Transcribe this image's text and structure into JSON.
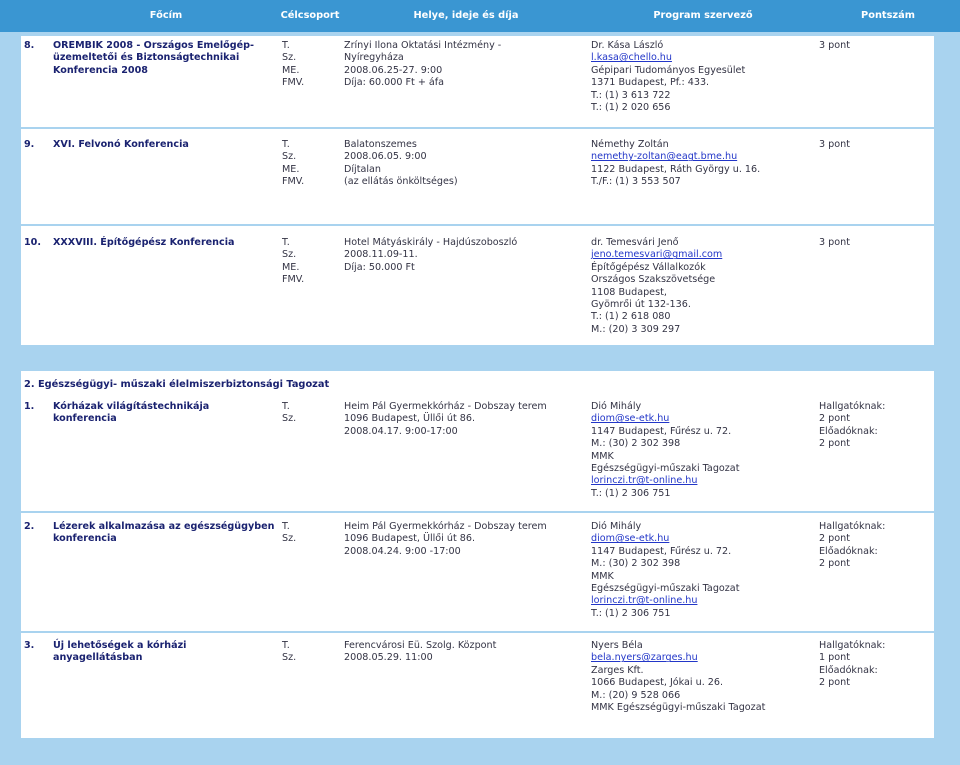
{
  "header": {
    "columns": [
      "Főcím",
      "Célcsoport",
      "Helye, ideje és díja",
      "Program szervező",
      "Pontszám"
    ]
  },
  "colors": {
    "header_bg": "#3a96d2",
    "page_bg": "#a9d3ef",
    "title_text": "#1a2270",
    "link": "#2236c8"
  },
  "sections": [
    {
      "rows": [
        {
          "num": "8.",
          "title": [
            "OREMBIK 2008 - Országos Emelőgép-",
            "üzemeltetői és Biztonságtechnikai",
            "Konferencia 2008"
          ],
          "labels": [
            "T.",
            "Sz.",
            "ME.",
            "FMV."
          ],
          "place": [
            "Zrínyi Ilona Oktatási Intézmény -",
            "Nyíregyháza",
            "2008.06.25-27. 9:00",
            "Díja: 60.000 Ft + áfa"
          ],
          "organizer": [
            "Dr. Kása László",
            "l.kasa@chello.hu",
            "Gépipari Tudományos Egyesület",
            "1371 Budapest, Pf.: 433.",
            "T.: (1) 3 613 722",
            "T.: (1) 2 020 656"
          ],
          "points": [
            "3 pont"
          ]
        },
        {
          "num": "9.",
          "title": [
            "XVI. Felvonó Konferencia"
          ],
          "labels": [
            "T.",
            "Sz.",
            "ME.",
            "FMV."
          ],
          "place": [
            "Balatonszemes",
            "2008.06.05. 9:00",
            "Díjtalan",
            "(az ellátás önköltséges)"
          ],
          "organizer": [
            "Némethy Zoltán",
            "nemethy-zoltan@eagt.bme.hu",
            "1122 Budapest, Ráth György u. 16.",
            "T./F.: (1) 3 553 507"
          ],
          "points": [
            "3 pont"
          ]
        },
        {
          "num": "10.",
          "title": [
            "XXXVIII. Építőgépész Konferencia"
          ],
          "labels": [
            "T.",
            "Sz.",
            "ME.",
            "FMV."
          ],
          "place": [
            "Hotel Mátyáskirály - Hajdúszoboszló",
            "2008.11.09-11.",
            "Díja: 50.000 Ft"
          ],
          "organizer": [
            "dr. Temesvári Jenő",
            "jeno.temesvari@gmail.com",
            "Építőgépész Vállalkozók",
            "Országos Szakszövetsége",
            "1108 Budapest,",
            "Gyömrői út 132-136.",
            "T.: (1) 2 618 080",
            "M.: (20) 3 309 297"
          ],
          "points": [
            "3 pont"
          ]
        }
      ]
    },
    {
      "heading": "2. Egészségügyi- műszaki élelmiszerbiztonsági Tagozat",
      "rows": [
        {
          "num": "1.",
          "title": [
            "Kórházak világítástechnikája",
            "konferencia"
          ],
          "labels": [
            "T.",
            "Sz."
          ],
          "place": [
            "Heim Pál Gyermekkórház - Dobszay terem",
            "1096 Budapest, Üllői út 86.",
            "2008.04.17. 9:00-17:00"
          ],
          "organizer": [
            "Dió Mihály",
            "diom@se-etk.hu",
            "1147 Budapest, Fűrész u. 72.",
            "M.: (30) 2 302 398",
            "MMK",
            "Egészségügyi-műszaki Tagozat",
            "lorinczi.tr@t-online.hu",
            "T.: (1) 2 306 751"
          ],
          "points": [
            "Hallgatóknak:",
            "2 pont",
            "Előadóknak:",
            "2 pont"
          ]
        },
        {
          "num": "2.",
          "title": [
            "Lézerek alkalmazása az egészségügyben",
            "konferencia"
          ],
          "labels": [
            "T.",
            "Sz."
          ],
          "place": [
            "Heim Pál Gyermekkórház - Dobszay terem",
            "1096 Budapest, Üllői út 86.",
            "2008.04.24. 9:00 -17:00"
          ],
          "organizer": [
            "Dió Mihály",
            "diom@se-etk.hu",
            "1147 Budapest, Fűrész u. 72.",
            "M.: (30) 2 302 398",
            "MMK",
            "Egészségügyi-műszaki Tagozat",
            "lorinczi.tr@t-online.hu",
            "T.: (1) 2 306 751"
          ],
          "points": [
            "Hallgatóknak:",
            "2 pont",
            "Előadóknak:",
            "2 pont"
          ]
        },
        {
          "num": "3.",
          "title": [
            "Új lehetőségek a kórházi",
            "anyagellátásban"
          ],
          "labels": [
            "T.",
            "Sz."
          ],
          "place": [
            "Ferencvárosi Eü. Szolg. Központ",
            "2008.05.29. 11:00"
          ],
          "organizer": [
            "Nyers Béla",
            "bela.nyers@zarges.hu",
            "Zarges Kft.",
            "1066 Budapest, Jókai u. 26.",
            "M.: (20) 9 528 066",
            "MMK Egészségügyi-műszaki Tagozat"
          ],
          "points": [
            "Hallgatóknak:",
            "1 pont",
            "Előadóknak:",
            "2 pont"
          ]
        }
      ]
    }
  ]
}
